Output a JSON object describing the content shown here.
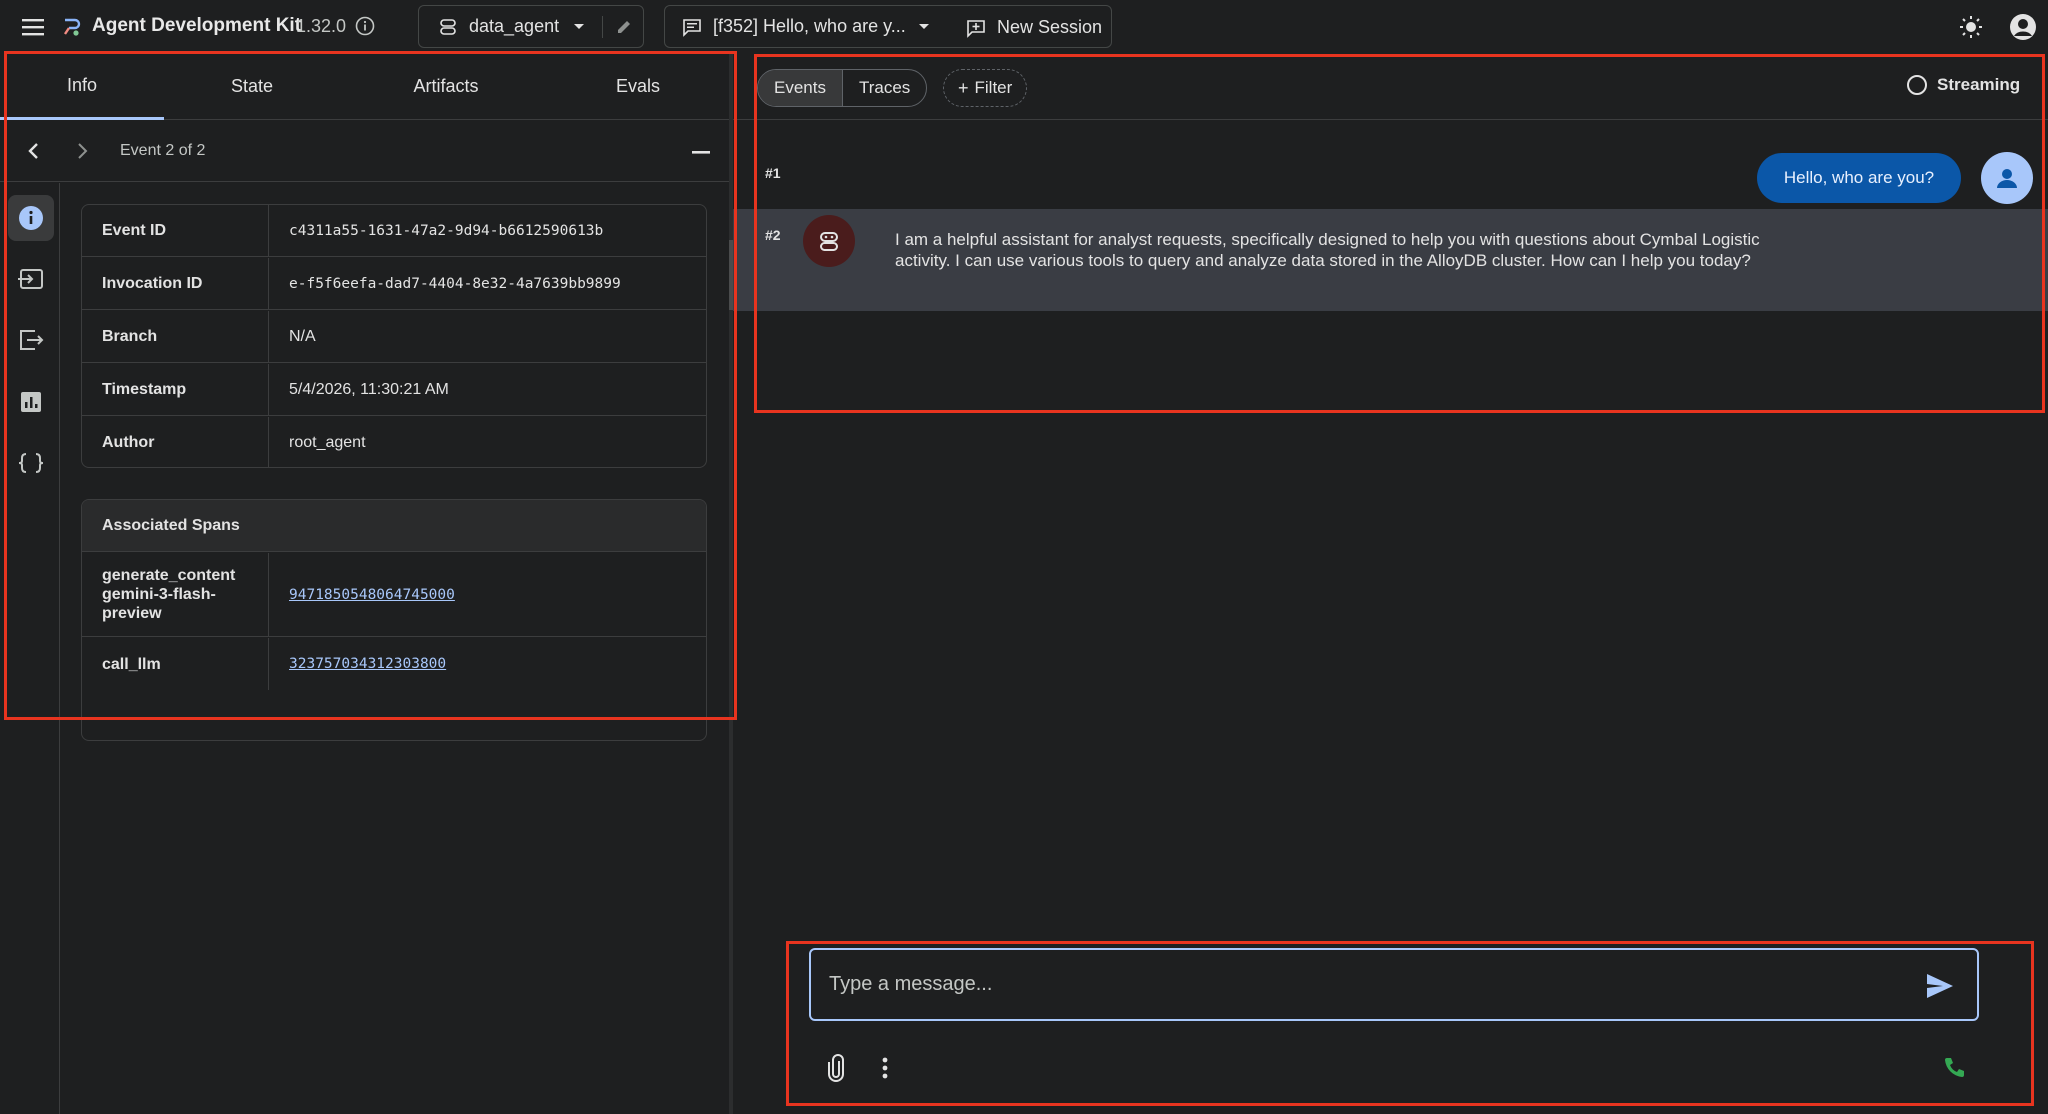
{
  "header": {
    "app_title": "Agent Development Kit",
    "version": "1.32.0",
    "agent_name": "data_agent",
    "session_name": "[f352] Hello, who are y...",
    "new_session_label": "New Session"
  },
  "left_tabs": {
    "info": "Info",
    "state": "State",
    "artifacts": "Artifacts",
    "evals": "Evals"
  },
  "event_nav": {
    "counter": "Event 2 of 2"
  },
  "event_info": [
    {
      "key": "Event ID",
      "value": "c4311a55-1631-47a2-9d94-b6612590613b"
    },
    {
      "key": "Invocation ID",
      "value": "e-f5f6eefa-dad7-4404-8e32-4a7639bb9899"
    },
    {
      "key": "Branch",
      "value": "N/A"
    },
    {
      "key": "Timestamp",
      "value": "5/4/2026, 11:30:21 AM"
    },
    {
      "key": "Author",
      "value": "root_agent"
    }
  ],
  "spans": {
    "title": "Associated Spans",
    "rows": [
      {
        "name_line1": "generate_content",
        "name_line2": "gemini-3-flash-",
        "name_line3": "preview",
        "id": "9471850548064745000"
      },
      {
        "name_line1": "call_llm",
        "id": "323757034312303800"
      }
    ]
  },
  "toolbar": {
    "events": "Events",
    "traces": "Traces",
    "filter": "Filter",
    "streaming": "Streaming"
  },
  "chat": {
    "event1_num": "#1",
    "user_message": "Hello, who are you?",
    "event2_num": "#2",
    "bot_message": "I am a helpful assistant for analyst requests, specifically designed to help you with questions about Cymbal Logistic activity. I can use various tools to query and analyze data stored in the AlloyDB cluster. How can I help you today?"
  },
  "composer": {
    "placeholder": "Type a message..."
  },
  "colors": {
    "accent": "#a8c7fa",
    "user_bubble": "#0b57a8",
    "highlight": "#e8341f",
    "call_green": "#34a853"
  }
}
